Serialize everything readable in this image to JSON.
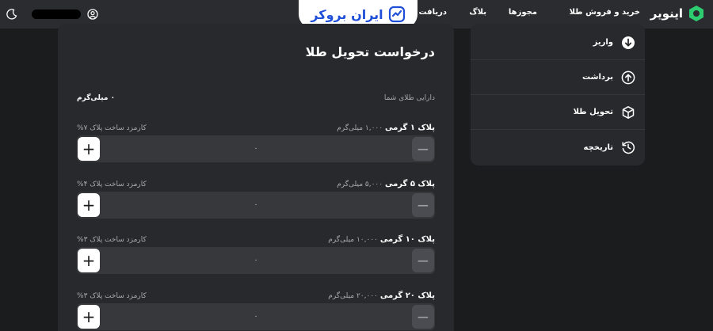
{
  "header": {
    "brand_name": "اینویر",
    "nav": [
      "خرید و فروش طلا",
      "مجوزها",
      "بلاگ",
      "دریافت وا"
    ],
    "watermark_text": "ایران بروکر"
  },
  "page": {
    "title": "درخواست تحویل طلا",
    "balance_label": "دارایی طلای شما",
    "balance_value": "۰ میلی‌گرم"
  },
  "plates": [
    {
      "title": "پلاک ۱ گرمی",
      "weight": "۱,۰۰۰ میلی‌گرم",
      "fee": "کارمزد ساخت پلاک ۷%",
      "quantity": "۰"
    },
    {
      "title": "پلاک ۵ گرمی",
      "weight": "۵,۰۰۰ میلی‌گرم",
      "fee": "کارمزد ساخت پلاک ۴%",
      "quantity": "۰"
    },
    {
      "title": "پلاک ۱۰ گرمی",
      "weight": "۱۰,۰۰۰ میلی‌گرم",
      "fee": "کارمزد ساخت پلاک ۳%",
      "quantity": "۰"
    },
    {
      "title": "پلاک ۲۰ گرمی",
      "weight": "۲۰,۰۰۰ میلی‌گرم",
      "fee": "کارمزد ساخت پلاک ۳%",
      "quantity": "۰"
    }
  ],
  "stepper": {
    "plus": "+",
    "minus": "−"
  },
  "sidebar": {
    "items": [
      {
        "label": "واریز",
        "icon": "arrow-down-circle-icon"
      },
      {
        "label": "برداشت",
        "icon": "arrow-up-circle-icon"
      },
      {
        "label": "تحویل طلا",
        "icon": "box-icon"
      },
      {
        "label": "تاریخچه",
        "icon": "history-icon"
      }
    ]
  },
  "colors": {
    "background": "#1b1c1e",
    "card": "#27292c",
    "topbar": "#2a2c2f",
    "brand_green": "#2ecc71",
    "watermark_blue": "#1f4fd9"
  }
}
